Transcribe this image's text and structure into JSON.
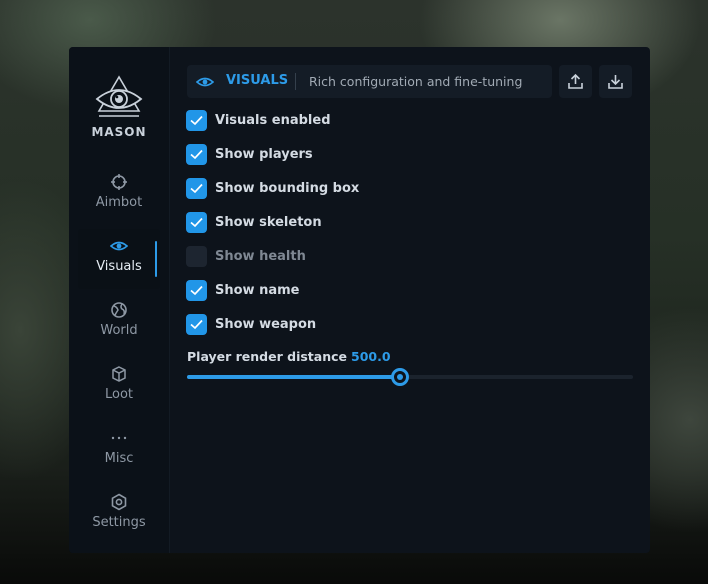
{
  "brand": {
    "name": "MASON",
    "logo_icon": "all-seeing-eye-icon"
  },
  "sidebar": {
    "items": [
      {
        "label": "Aimbot",
        "icon": "crosshair-icon",
        "active": false
      },
      {
        "label": "Visuals",
        "icon": "eye-icon",
        "active": true
      },
      {
        "label": "World",
        "icon": "globe-icon",
        "active": false
      },
      {
        "label": "Loot",
        "icon": "cube-icon",
        "active": false
      },
      {
        "label": "Misc",
        "icon": "ellipsis-icon",
        "active": false
      },
      {
        "label": "Settings",
        "icon": "gear-icon",
        "active": false
      }
    ]
  },
  "header": {
    "section_title": "VISUALS",
    "description": "Rich configuration and fine-tuning",
    "export_icon": "upload-icon",
    "import_icon": "download-icon"
  },
  "options": [
    {
      "label": "Visuals enabled",
      "checked": true
    },
    {
      "label": "Show players",
      "checked": true
    },
    {
      "label": "Show bounding box",
      "checked": true
    },
    {
      "label": "Show skeleton",
      "checked": true
    },
    {
      "label": "Show health",
      "checked": false
    },
    {
      "label": "Show name",
      "checked": true
    },
    {
      "label": "Show weapon",
      "checked": true
    }
  ],
  "render_distance": {
    "label": "Player render distance",
    "value_text": "500.0",
    "fraction": 0.476
  },
  "colors": {
    "accent": "#2d9be8",
    "panel": "#0d131b",
    "sidebar": "#0b1118"
  }
}
